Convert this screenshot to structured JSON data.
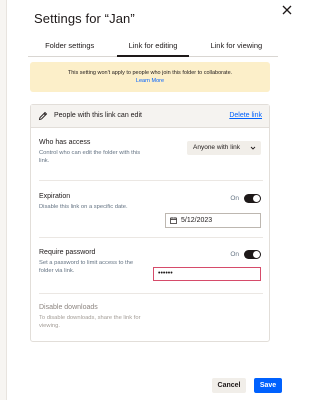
{
  "dialog": {
    "title": "Settings for “Jan”",
    "tabs": [
      {
        "label": "Folder settings",
        "active": false
      },
      {
        "label": "Link for editing",
        "active": true
      },
      {
        "label": "Link for viewing",
        "active": false
      }
    ],
    "notice": {
      "text": "This setting won't apply to people who join this folder to collaborate.",
      "link": "Learn More"
    },
    "panel": {
      "header": "People with this link can edit",
      "delete_link": "Delete link",
      "who_has_access": {
        "title": "Who has access",
        "desc": "Control who can edit the folder with this link.",
        "value": "Anyone with link"
      },
      "expiration": {
        "title": "Expiration",
        "desc": "Disable this link on a specific date.",
        "toggle_label": "On",
        "date": "5/12/2023"
      },
      "require_password": {
        "title": "Require password",
        "desc": "Set a password to limit access to the folder via link.",
        "toggle_label": "On",
        "password_mask": "••••••"
      },
      "disable_downloads": {
        "title": "Disable downloads",
        "desc": "To disable downloads, share the link for viewing."
      }
    },
    "buttons": {
      "cancel": "Cancel",
      "save": "Save"
    }
  },
  "colors": {
    "accent": "#0061fe",
    "notice_bg": "#fcefc9",
    "error_border": "#d64b6a"
  }
}
